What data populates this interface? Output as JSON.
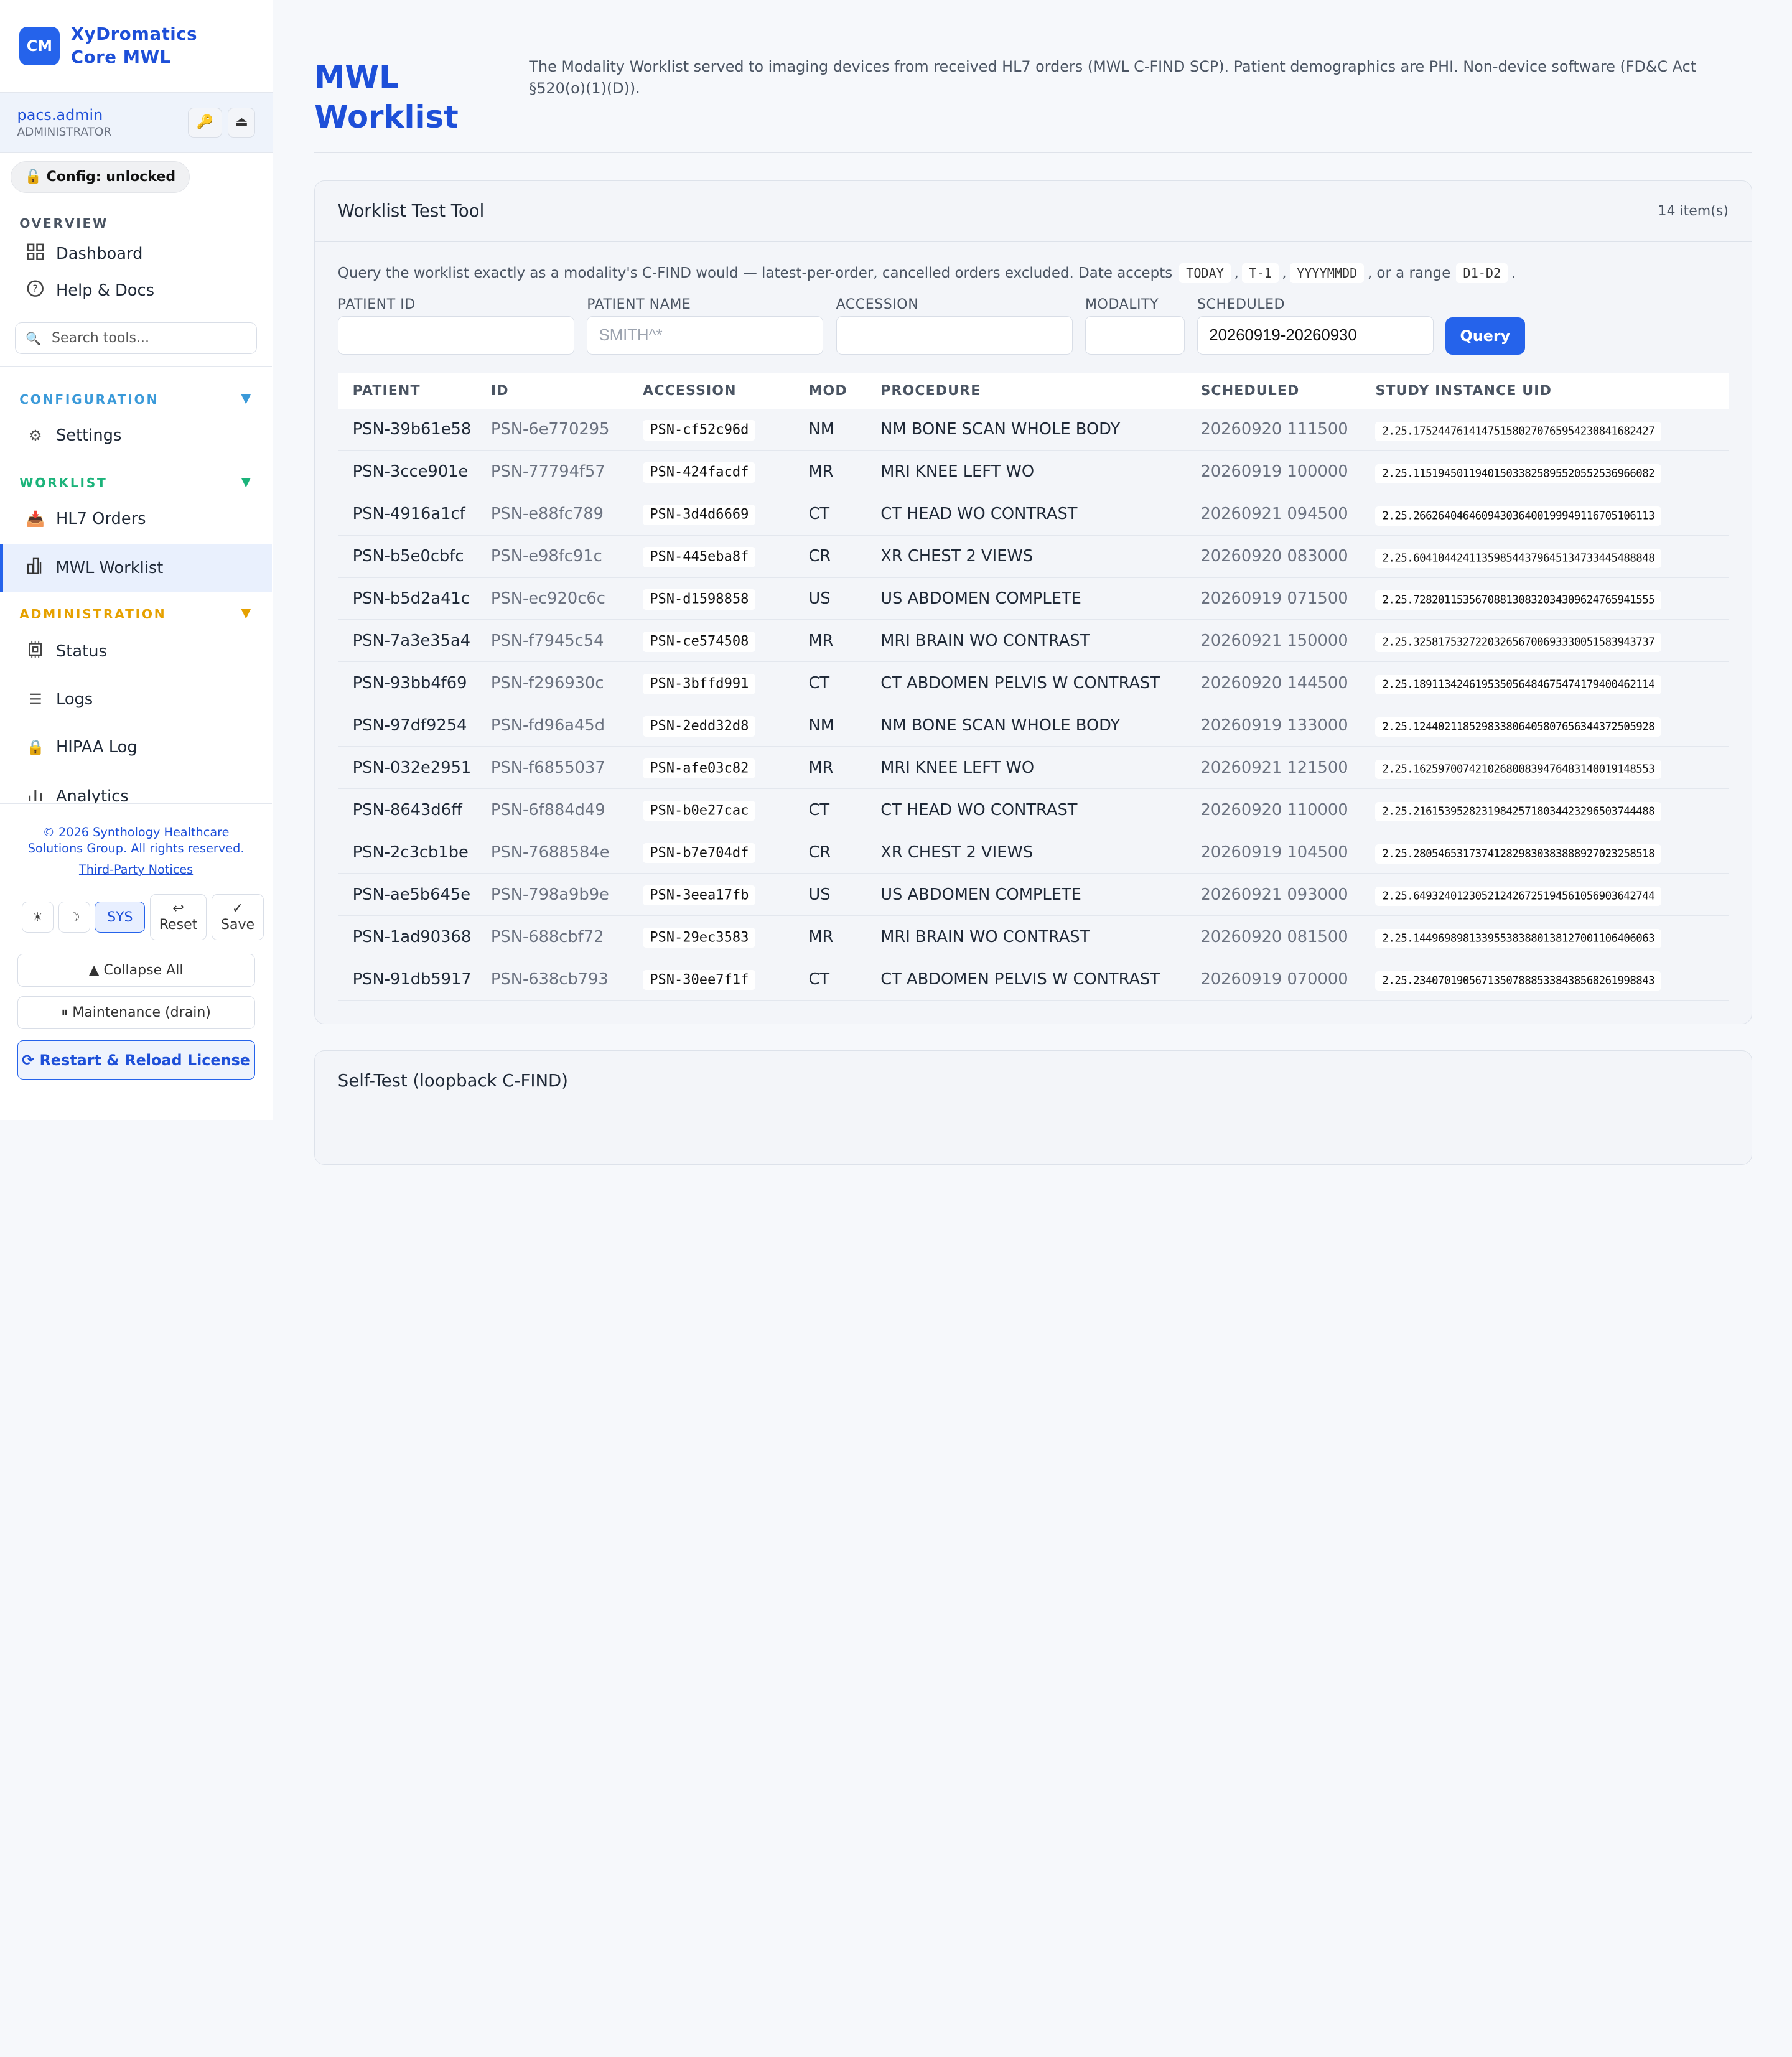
{
  "brand": {
    "logo": "CM",
    "name_line1": "XyDromatics",
    "name_line2": "Core MWL"
  },
  "user": {
    "name": "pacs.admin",
    "role": "ADMINISTRATOR",
    "key_icon": "🔑",
    "eject_icon": "⏏"
  },
  "config_status": "🔓 Config: unlocked",
  "sections": {
    "overview": "OVERVIEW",
    "configuration": "CONFIGURATION",
    "worklist": "WORKLIST",
    "administration": "ADMINISTRATION"
  },
  "section_colors": {
    "configuration": "#3b9ad9",
    "worklist": "#1bb37a",
    "administration": "#e6a100"
  },
  "nav": {
    "dashboard": "Dashboard",
    "help": "Help & Docs",
    "search_placeholder": "Search tools...",
    "settings": "Settings",
    "hl7_orders": "HL7 Orders",
    "mwl_worklist": "MWL Worklist",
    "status": "Status",
    "logs": "Logs",
    "hipaa": "HIPAA Log",
    "analytics": "Analytics"
  },
  "footer": {
    "copyright_line1": "© 2026 Synthology Healthcare",
    "copyright_line2": "Solutions Group. All rights reserved.",
    "notices": "Third-Party Notices",
    "theme_light": "☀",
    "theme_dark": "☽",
    "theme_sys": "SYS",
    "reset_icon": "↩",
    "reset": "Reset",
    "save_icon": "✓",
    "save": "Save",
    "collapse": "▲ Collapse All",
    "maintenance": "⏸ Maintenance (drain)",
    "restart": "⟳ Restart & Reload License"
  },
  "page": {
    "title_line1": "MWL",
    "title_line2": "Worklist",
    "description": "The Modality Worklist served to imaging devices from received HL7 orders (MWL C-FIND SCP). Patient demographics are PHI. Non-device software (FD&C Act §520(o)(1)(D))."
  },
  "tool": {
    "title": "Worklist Test Tool",
    "count": "14 item(s)",
    "help_prefix": "Query the worklist exactly as a modality's C-FIND would — latest-per-order, cancelled orders excluded. Date accepts",
    "code_today": "TODAY",
    "code_t1": "T-1",
    "code_date": "YYYYMMDD",
    "help_mid": ", or a range",
    "code_range": "D1-D2",
    "help_end": ".",
    "labels": {
      "patient_id": "PATIENT ID",
      "patient_name": "PATIENT NAME",
      "accession": "ACCESSION",
      "modality": "MODALITY",
      "scheduled": "SCHEDULED"
    },
    "patient_name_placeholder": "SMITH^*",
    "scheduled_value": "20260919-20260930",
    "query": "Query"
  },
  "table": {
    "headers": [
      "PATIENT",
      "ID",
      "ACCESSION",
      "MOD",
      "PROCEDURE",
      "SCHEDULED",
      "STUDY INSTANCE UID"
    ],
    "rows": [
      [
        "PSN-39b61e58",
        "PSN-6e770295",
        "PSN-cf52c96d",
        "NM",
        "NM BONE SCAN WHOLE BODY",
        "20260920 111500",
        "2.25.175244761414751580270765954230841682427"
      ],
      [
        "PSN-3cce901e",
        "PSN-77794f57",
        "PSN-424facdf",
        "MR",
        "MRI KNEE LEFT WO",
        "20260919 100000",
        "2.25.115194501194015033825895520552536966082"
      ],
      [
        "PSN-4916a1cf",
        "PSN-e88fc789",
        "PSN-3d4d6669",
        "CT",
        "CT HEAD WO CONTRAST",
        "20260921 094500",
        "2.25.266264046460943036400199949116705106113"
      ],
      [
        "PSN-b5e0cbfc",
        "PSN-e98fc91c",
        "PSN-445eba8f",
        "CR",
        "XR CHEST 2 VIEWS",
        "20260920 083000",
        "2.25.604104424113598544379645134733445488848"
      ],
      [
        "PSN-b5d2a41c",
        "PSN-ec920c6c",
        "PSN-d1598858",
        "US",
        "US ABDOMEN COMPLETE",
        "20260919 071500",
        "2.25.728201153567088130832034309624765941555"
      ],
      [
        "PSN-7a3e35a4",
        "PSN-f7945c54",
        "PSN-ce574508",
        "MR",
        "MRI BRAIN WO CONTRAST",
        "20260921 150000",
        "2.25.325817532722032656700693330051583943737"
      ],
      [
        "PSN-93bb4f69",
        "PSN-f296930c",
        "PSN-3bffd991",
        "CT",
        "CT ABDOMEN PELVIS W CONTRAST",
        "20260920 144500",
        "2.25.189113424619535056484675474179400462114"
      ],
      [
        "PSN-97df9254",
        "PSN-fd96a45d",
        "PSN-2edd32d8",
        "NM",
        "NM BONE SCAN WHOLE BODY",
        "20260919 133000",
        "2.25.124402118529833806405807656344372505928"
      ],
      [
        "PSN-032e2951",
        "PSN-f6855037",
        "PSN-afe03c82",
        "MR",
        "MRI KNEE LEFT WO",
        "20260921 121500",
        "2.25.162597007421026800839476483140019148553"
      ],
      [
        "PSN-8643d6ff",
        "PSN-6f884d49",
        "PSN-b0e27cac",
        "CT",
        "CT HEAD WO CONTRAST",
        "20260920 110000",
        "2.25.216153952823198425718034423296503744488"
      ],
      [
        "PSN-2c3cb1be",
        "PSN-7688584e",
        "PSN-b7e704df",
        "CR",
        "XR CHEST 2 VIEWS",
        "20260919 104500",
        "2.25.280546531737412829830383888927023258518"
      ],
      [
        "PSN-ae5b645e",
        "PSN-798a9b9e",
        "PSN-3eea17fb",
        "US",
        "US ABDOMEN COMPLETE",
        "20260921 093000",
        "2.25.649324012305212426725194561056903642744"
      ],
      [
        "PSN-1ad90368",
        "PSN-688cbf72",
        "PSN-29ec3583",
        "MR",
        "MRI BRAIN WO CONTRAST",
        "20260920 081500",
        "2.25.144969898133955383880138127001106406063"
      ],
      [
        "PSN-91db5917",
        "PSN-638cb793",
        "PSN-30ee7f1f",
        "CT",
        "CT ABDOMEN PELVIS W CONTRAST",
        "20260919 070000",
        "2.25.234070190567135078885338438568261998843"
      ]
    ]
  },
  "selftest": {
    "title": "Self-Test (loopback C-FIND)"
  }
}
